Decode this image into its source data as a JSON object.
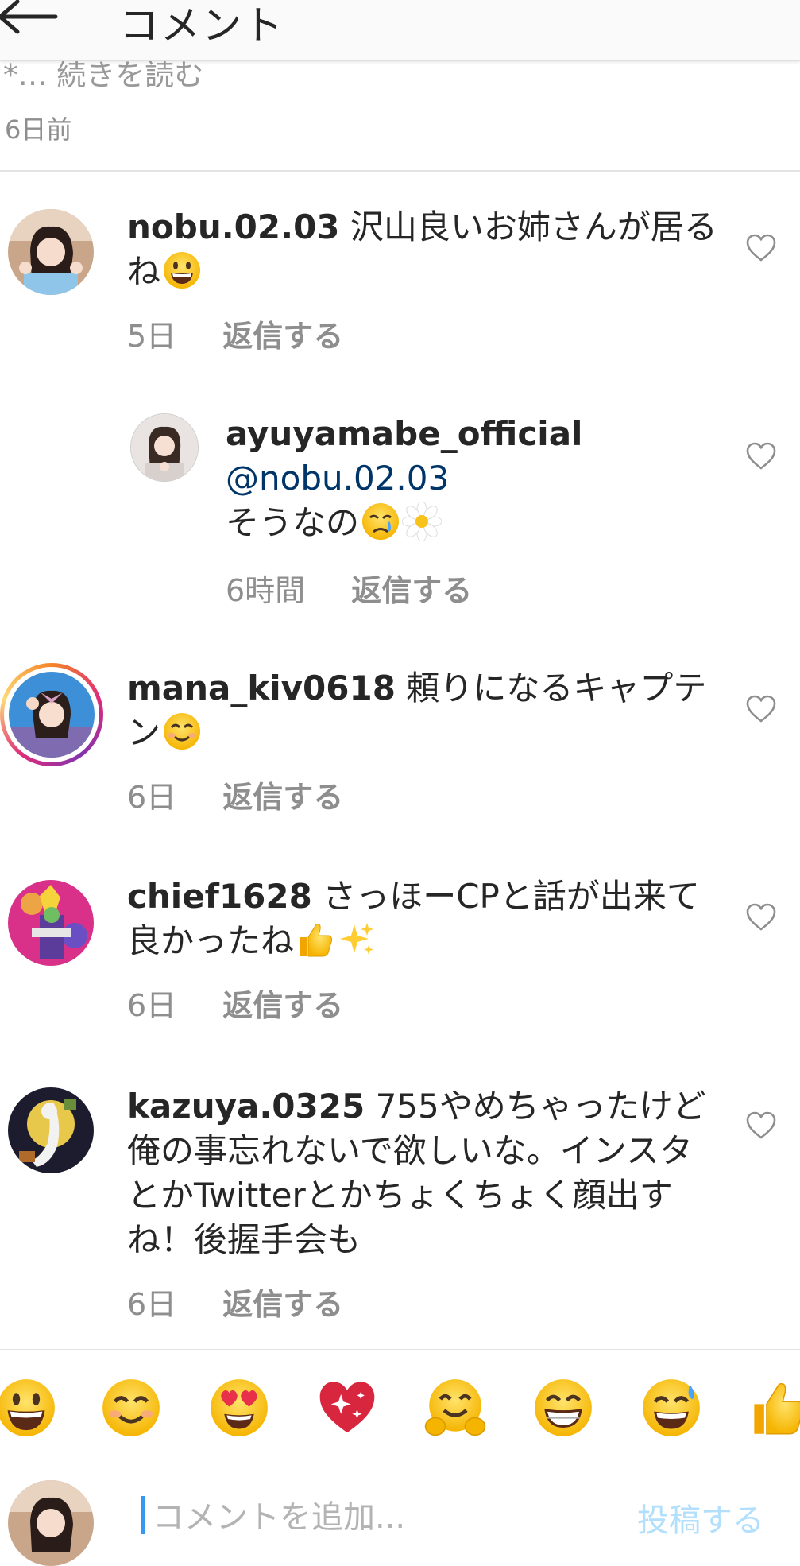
{
  "header": {
    "title": "コメント",
    "back_icon": "back-arrow-icon"
  },
  "caption": {
    "more_text": "*… 続きを読む",
    "time": "6日前"
  },
  "comments": [
    {
      "username": "nobu.02.03",
      "text": "沢山良いお姉さんが居るね",
      "emoji": "grinning-face",
      "time": "5日",
      "reply": "返信する"
    },
    {
      "username": "ayuyamabe_official",
      "mention": "@nobu.02.03",
      "text": "そうなの",
      "emoji": [
        "sad-tear-face",
        "daisy-flower"
      ],
      "time": "6時間",
      "reply": "返信する"
    },
    {
      "username": "mana_kiv0618",
      "text": "頼りになるキャプテン",
      "emoji": "smiling-face",
      "time": "6日",
      "reply": "返信する",
      "story_ring": true
    },
    {
      "username": "chief1628",
      "text": "さっほーCPと話が出来て良かったね",
      "emoji": [
        "thumbs-up",
        "sparkles"
      ],
      "time": "6日",
      "reply": "返信する"
    },
    {
      "username": "kazuya.0325",
      "text": "755やめちゃったけど俺の事忘れないで欲しいな。インスタとかTwitterとかちょくちょく顔出すね！後握手会も",
      "time": "6日",
      "reply": "返信する"
    }
  ],
  "quick_emojis": [
    "grinning-face",
    "smiling-face",
    "heart-eyes-face",
    "sparkling-heart",
    "hugging-face",
    "beaming-face",
    "sweat-smile-face",
    "thumbs-up"
  ],
  "composer": {
    "placeholder": "コメントを追加...",
    "post_label": "投稿する"
  },
  "colors": {
    "accent": "#3897f0",
    "post_disabled": "#b2dffc",
    "mention": "#003569",
    "meta_gray": "#8e8e8e"
  }
}
